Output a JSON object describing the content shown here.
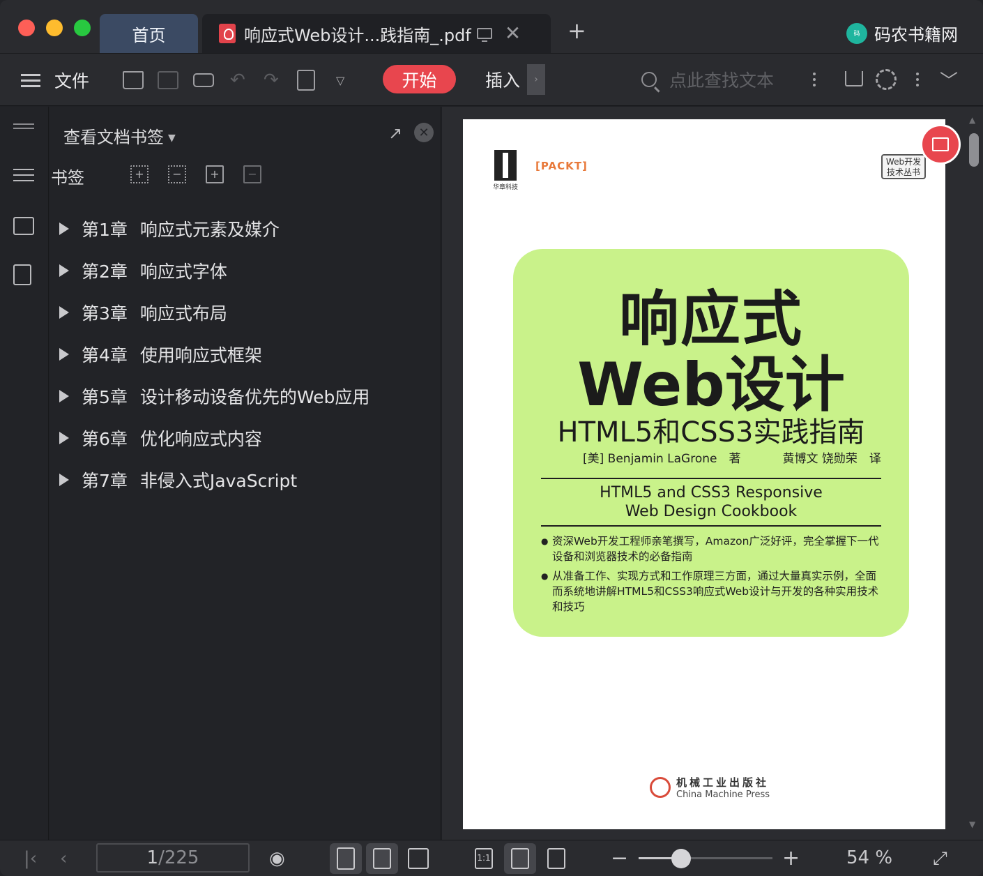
{
  "titlebar": {
    "home_tab": "首页",
    "doc_tab": "响应式Web设计...践指南_.pdf",
    "add_tab": "+",
    "close_tab": "✕",
    "brand": "码农书籍网"
  },
  "toolbar": {
    "file_label": "文件",
    "start_label": "开始",
    "insert_label": "插入",
    "search_placeholder": "点此查找文本",
    "accent": "#e8464e"
  },
  "panel": {
    "title": "查看文档书签",
    "bookmark_label": "书签",
    "bookmarks": [
      {
        "chapter": "第1章",
        "title": "响应式元素及媒介"
      },
      {
        "chapter": "第2章",
        "title": "响应式字体"
      },
      {
        "chapter": "第3章",
        "title": "响应式布局"
      },
      {
        "chapter": "第4章",
        "title": "使用响应式框架"
      },
      {
        "chapter": "第5章",
        "title": "设计移动设备优先的Web应用"
      },
      {
        "chapter": "第6章",
        "title": "优化响应式内容"
      },
      {
        "chapter": "第7章",
        "title": "非侵入式JavaScript"
      }
    ]
  },
  "page": {
    "hz_text": "华章科技",
    "packt": "[PACKT]",
    "series": "Web开发\n技术丛书",
    "title_line1": "响应式",
    "title_line2": "Web设计",
    "subtitle": "HTML5和CSS3实践指南",
    "author": "[美] Benjamin LaGrone　著",
    "translators": "黄博文 饶勋荣　译",
    "english_title_1": "HTML5 and CSS3 Responsive",
    "english_title_2": "Web Design Cookbook",
    "bullet_1": "资深Web开发工程师亲笔撰写，Amazon广泛好评，完全掌握下一代设备和浏览器技术的必备指南",
    "bullet_2": "从准备工作、实现方式和工作原理三方面，通过大量真实示例，全面而系统地讲解HTML5和CSS3响应式Web设计与开发的各种实用技术和技巧",
    "publisher_cn": "机械工业出版社",
    "publisher_en": "China Machine Press",
    "cover_color": "#c9f28a"
  },
  "status": {
    "current_page": "1",
    "total_pages": "/225",
    "zoom_level": "54 %",
    "zoom_fraction": 0.32
  }
}
